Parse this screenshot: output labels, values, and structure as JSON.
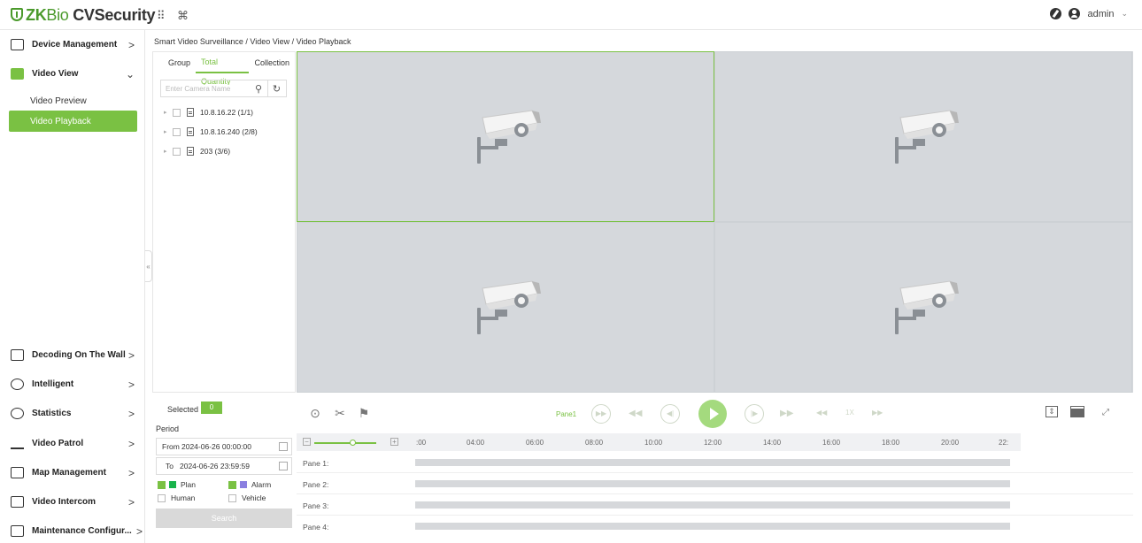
{
  "app": {
    "logo_zk": "ZK",
    "logo_bio": "Bio",
    "logo_product": " CVSecurity",
    "user": "admin",
    "user_caret": "⌄"
  },
  "topbar_icons": [
    "apps-grid-icon",
    "command-icon"
  ],
  "sidebar": {
    "items": [
      {
        "label": "Device Management",
        "arrow": ">"
      },
      {
        "label": "Video View",
        "arrow": "⌄"
      },
      {
        "label": "Decoding On The Wall",
        "arrow": ">"
      },
      {
        "label": "Intelligent",
        "arrow": ">"
      },
      {
        "label": "Statistics",
        "arrow": ">"
      },
      {
        "label": "Video Patrol",
        "arrow": ">"
      },
      {
        "label": "Map Management",
        "arrow": ">"
      },
      {
        "label": "Video Intercom",
        "arrow": ">"
      },
      {
        "label": "Maintenance Configur...",
        "arrow": ">"
      }
    ],
    "sub_items": [
      {
        "label": "Video Preview"
      },
      {
        "label": "Video Playback"
      }
    ],
    "collapse_glyph": "«"
  },
  "breadcrumb": "Smart Video Surveillance / Video View / Video Playback",
  "panel": {
    "tabs": [
      "Group",
      "Total Quantity",
      "Collection"
    ],
    "active_tab": "Total Quantity",
    "search_placeholder": "Enter Camera Name",
    "tree": [
      {
        "label": "10.8.16.22 (1/1)"
      },
      {
        "label": "10.8.16.240 (2/8)"
      },
      {
        "label": "203 (3/6)"
      }
    ],
    "selected_label": "Selected",
    "selected_count": "0",
    "period_label": "Period",
    "from_label": "From",
    "from_value": "2024-06-26 00:00:00",
    "to_label": "To",
    "to_value": "2024-06-26 23:59:59",
    "legend": {
      "plan": "Plan",
      "alarm": "Alarm",
      "human": "Human",
      "vehicle": "Vehicle",
      "plan_color": "#19b34b",
      "alarm_color": "#8a7fe0"
    },
    "search_button": "Search"
  },
  "controls": {
    "pane_label": "Pane1",
    "speed": "1X"
  },
  "timeline": {
    "ticks": [
      ":00",
      "04:00",
      "06:00",
      "08:00",
      "10:00",
      "12:00",
      "14:00",
      "16:00",
      "18:00",
      "20:00",
      "22:"
    ],
    "panes": [
      "Pane 1:",
      "Pane 2:",
      "Pane 3:",
      "Pane 4:"
    ]
  },
  "colors": {
    "accent": "#7ac143",
    "video_bg": "#d5d8dc"
  }
}
